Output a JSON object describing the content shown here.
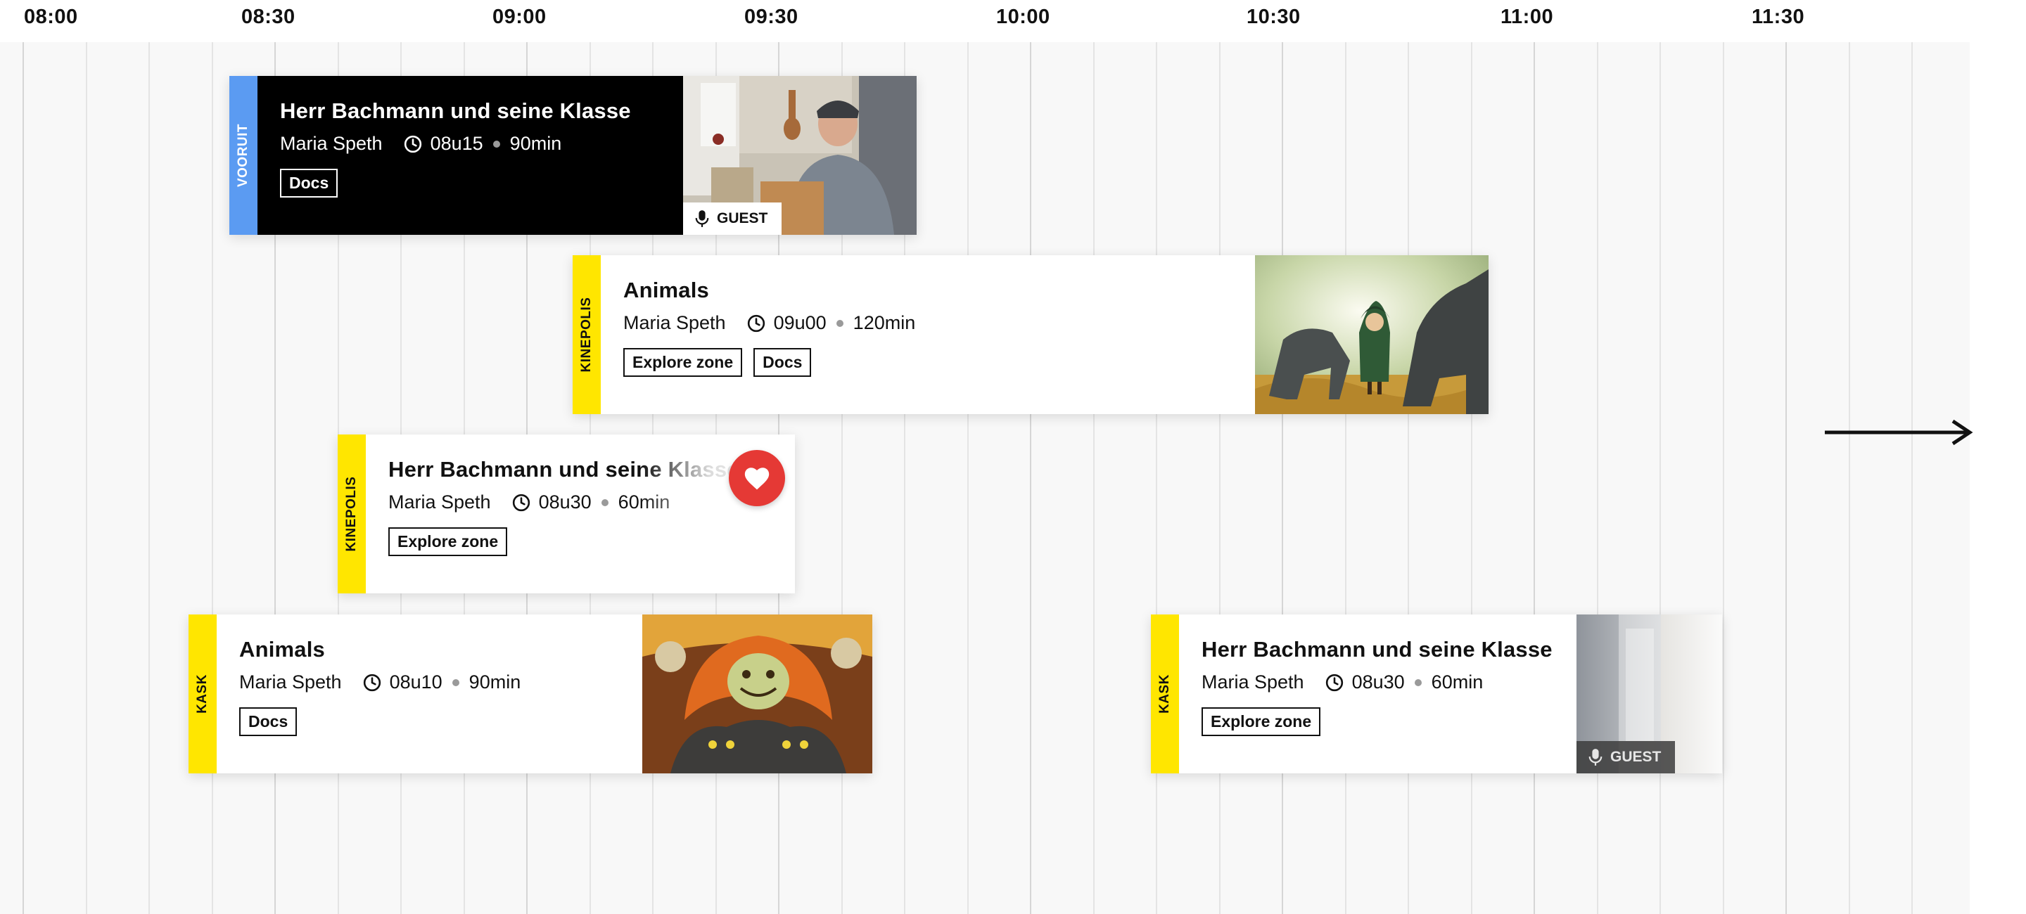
{
  "times": [
    "08:00",
    "08:30",
    "09:00",
    "09:30",
    "10:00",
    "10:30",
    "11:00",
    "11:30"
  ],
  "colors": {
    "vooruit": "#5b9bf2",
    "kinepolis": "#ffe600",
    "kask": "#ffe600",
    "heart": "#e53935"
  },
  "events": [
    {
      "venue": "VOORUIT",
      "title": "Herr Bachmann und seine Klasse",
      "director": "Maria Speth",
      "time": "08u15",
      "duration": "90min",
      "tags": [
        "Docs"
      ],
      "guest_label": "GUEST",
      "favorite": false,
      "theme": "dark"
    },
    {
      "venue": "KINEPOLIS",
      "title": "Animals",
      "director": "Maria Speth",
      "time": "09u00",
      "duration": "120min",
      "tags": [
        "Explore zone",
        "Docs"
      ],
      "favorite": false
    },
    {
      "venue": "KINEPOLIS",
      "title": "Herr Bachmann und seine Klasse",
      "director": "Maria Speth",
      "time": "08u30",
      "duration": "60min",
      "tags": [
        "Explore zone"
      ],
      "favorite": true
    },
    {
      "venue": "KASK",
      "title": "Animals",
      "director": "Maria Speth",
      "time": "08u10",
      "duration": "90min",
      "tags": [
        "Docs"
      ],
      "favorite": false
    },
    {
      "venue": "KASK",
      "title": "Herr Bachmann und seine Klasse",
      "director": "Maria Speth",
      "time": "08u30",
      "duration": "60min",
      "tags": [
        "Explore zone"
      ],
      "guest_label": "GUEST",
      "favorite": false
    }
  ],
  "icons": {
    "clock": "clock-icon",
    "mic": "microphone-icon",
    "heart": "heart-icon",
    "arrow": "arrow-right-icon"
  }
}
